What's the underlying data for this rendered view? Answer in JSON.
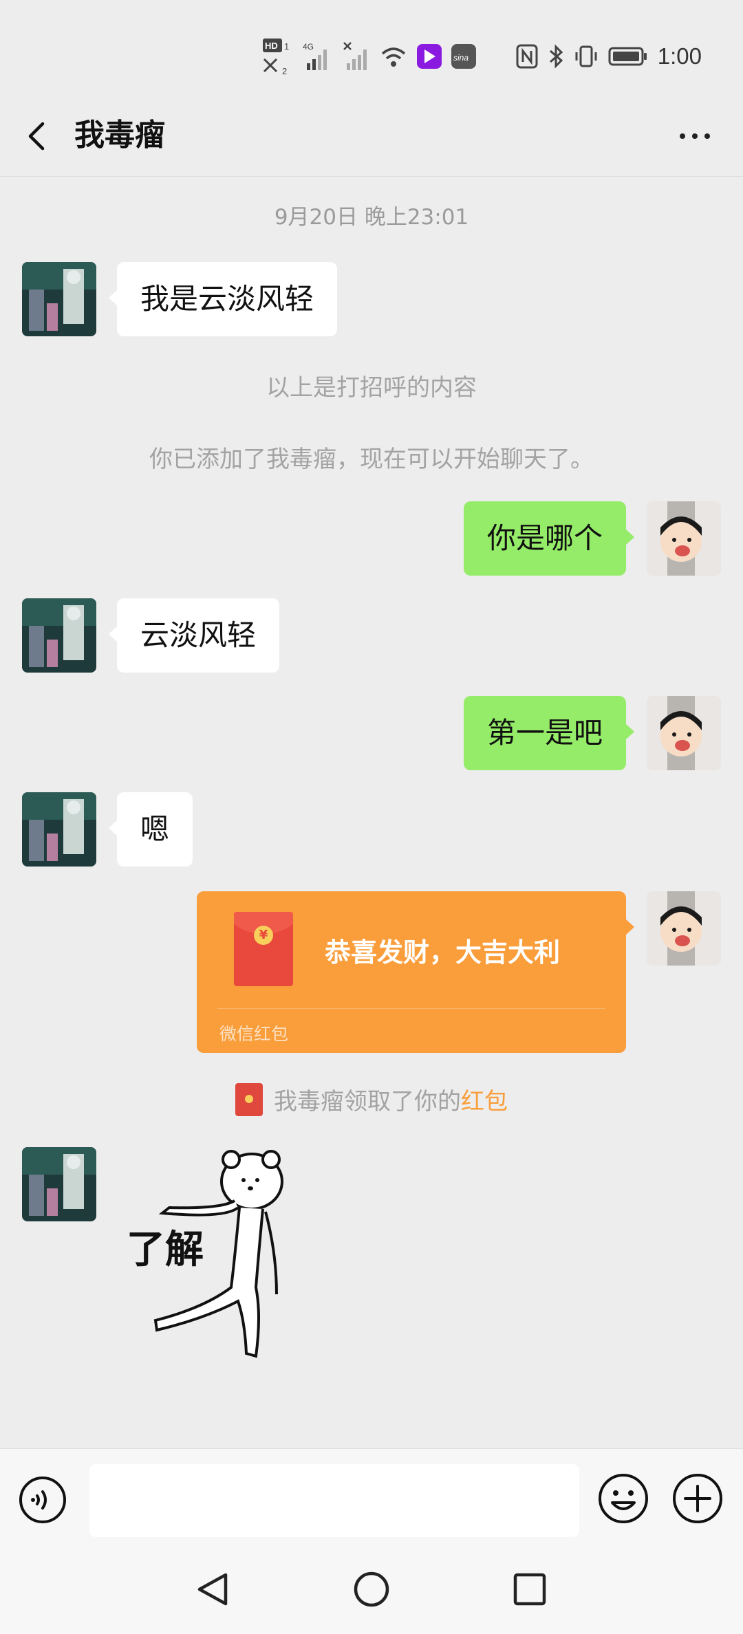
{
  "status_bar": {
    "time": "1:00",
    "left_icons": [
      "hd-icon",
      "network-4g-icon",
      "signal-icon",
      "signal-x-icon",
      "wifi-icon",
      "app-notify-icon",
      "weibo-icon"
    ],
    "right_icons": [
      "nfc-icon",
      "bluetooth-icon",
      "vibrate-icon",
      "battery-icon"
    ]
  },
  "header": {
    "title": "我毒瘤"
  },
  "chat": {
    "timestamp": "9月20日 晚上23:01",
    "messages": [
      {
        "side": "left",
        "text": "我是云淡风轻"
      },
      {
        "side": "right",
        "text": "你是哪个"
      },
      {
        "side": "left",
        "text": "云淡风轻"
      },
      {
        "side": "right",
        "text": "第一是吧"
      },
      {
        "side": "left",
        "text": "嗯"
      }
    ],
    "system_greeting": "以上是打招呼的内容",
    "system_added": "你已添加了我毒瘤，现在可以开始聊天了。",
    "red_packet": {
      "title": "恭喜发财，大吉大利",
      "label": "微信红包",
      "coin_symbol": "¥"
    },
    "red_packet_notice": {
      "prefix": "我毒瘤领取了你的",
      "link": "红包"
    },
    "sticker": {
      "caption": "了解",
      "icon": "bear-sticker"
    }
  },
  "input_bar": {
    "placeholder": "",
    "value": ""
  },
  "colors": {
    "background": "#ededed",
    "my_bubble": "#95ec69",
    "their_bubble": "#ffffff",
    "red_packet": "#fa9d3b"
  }
}
